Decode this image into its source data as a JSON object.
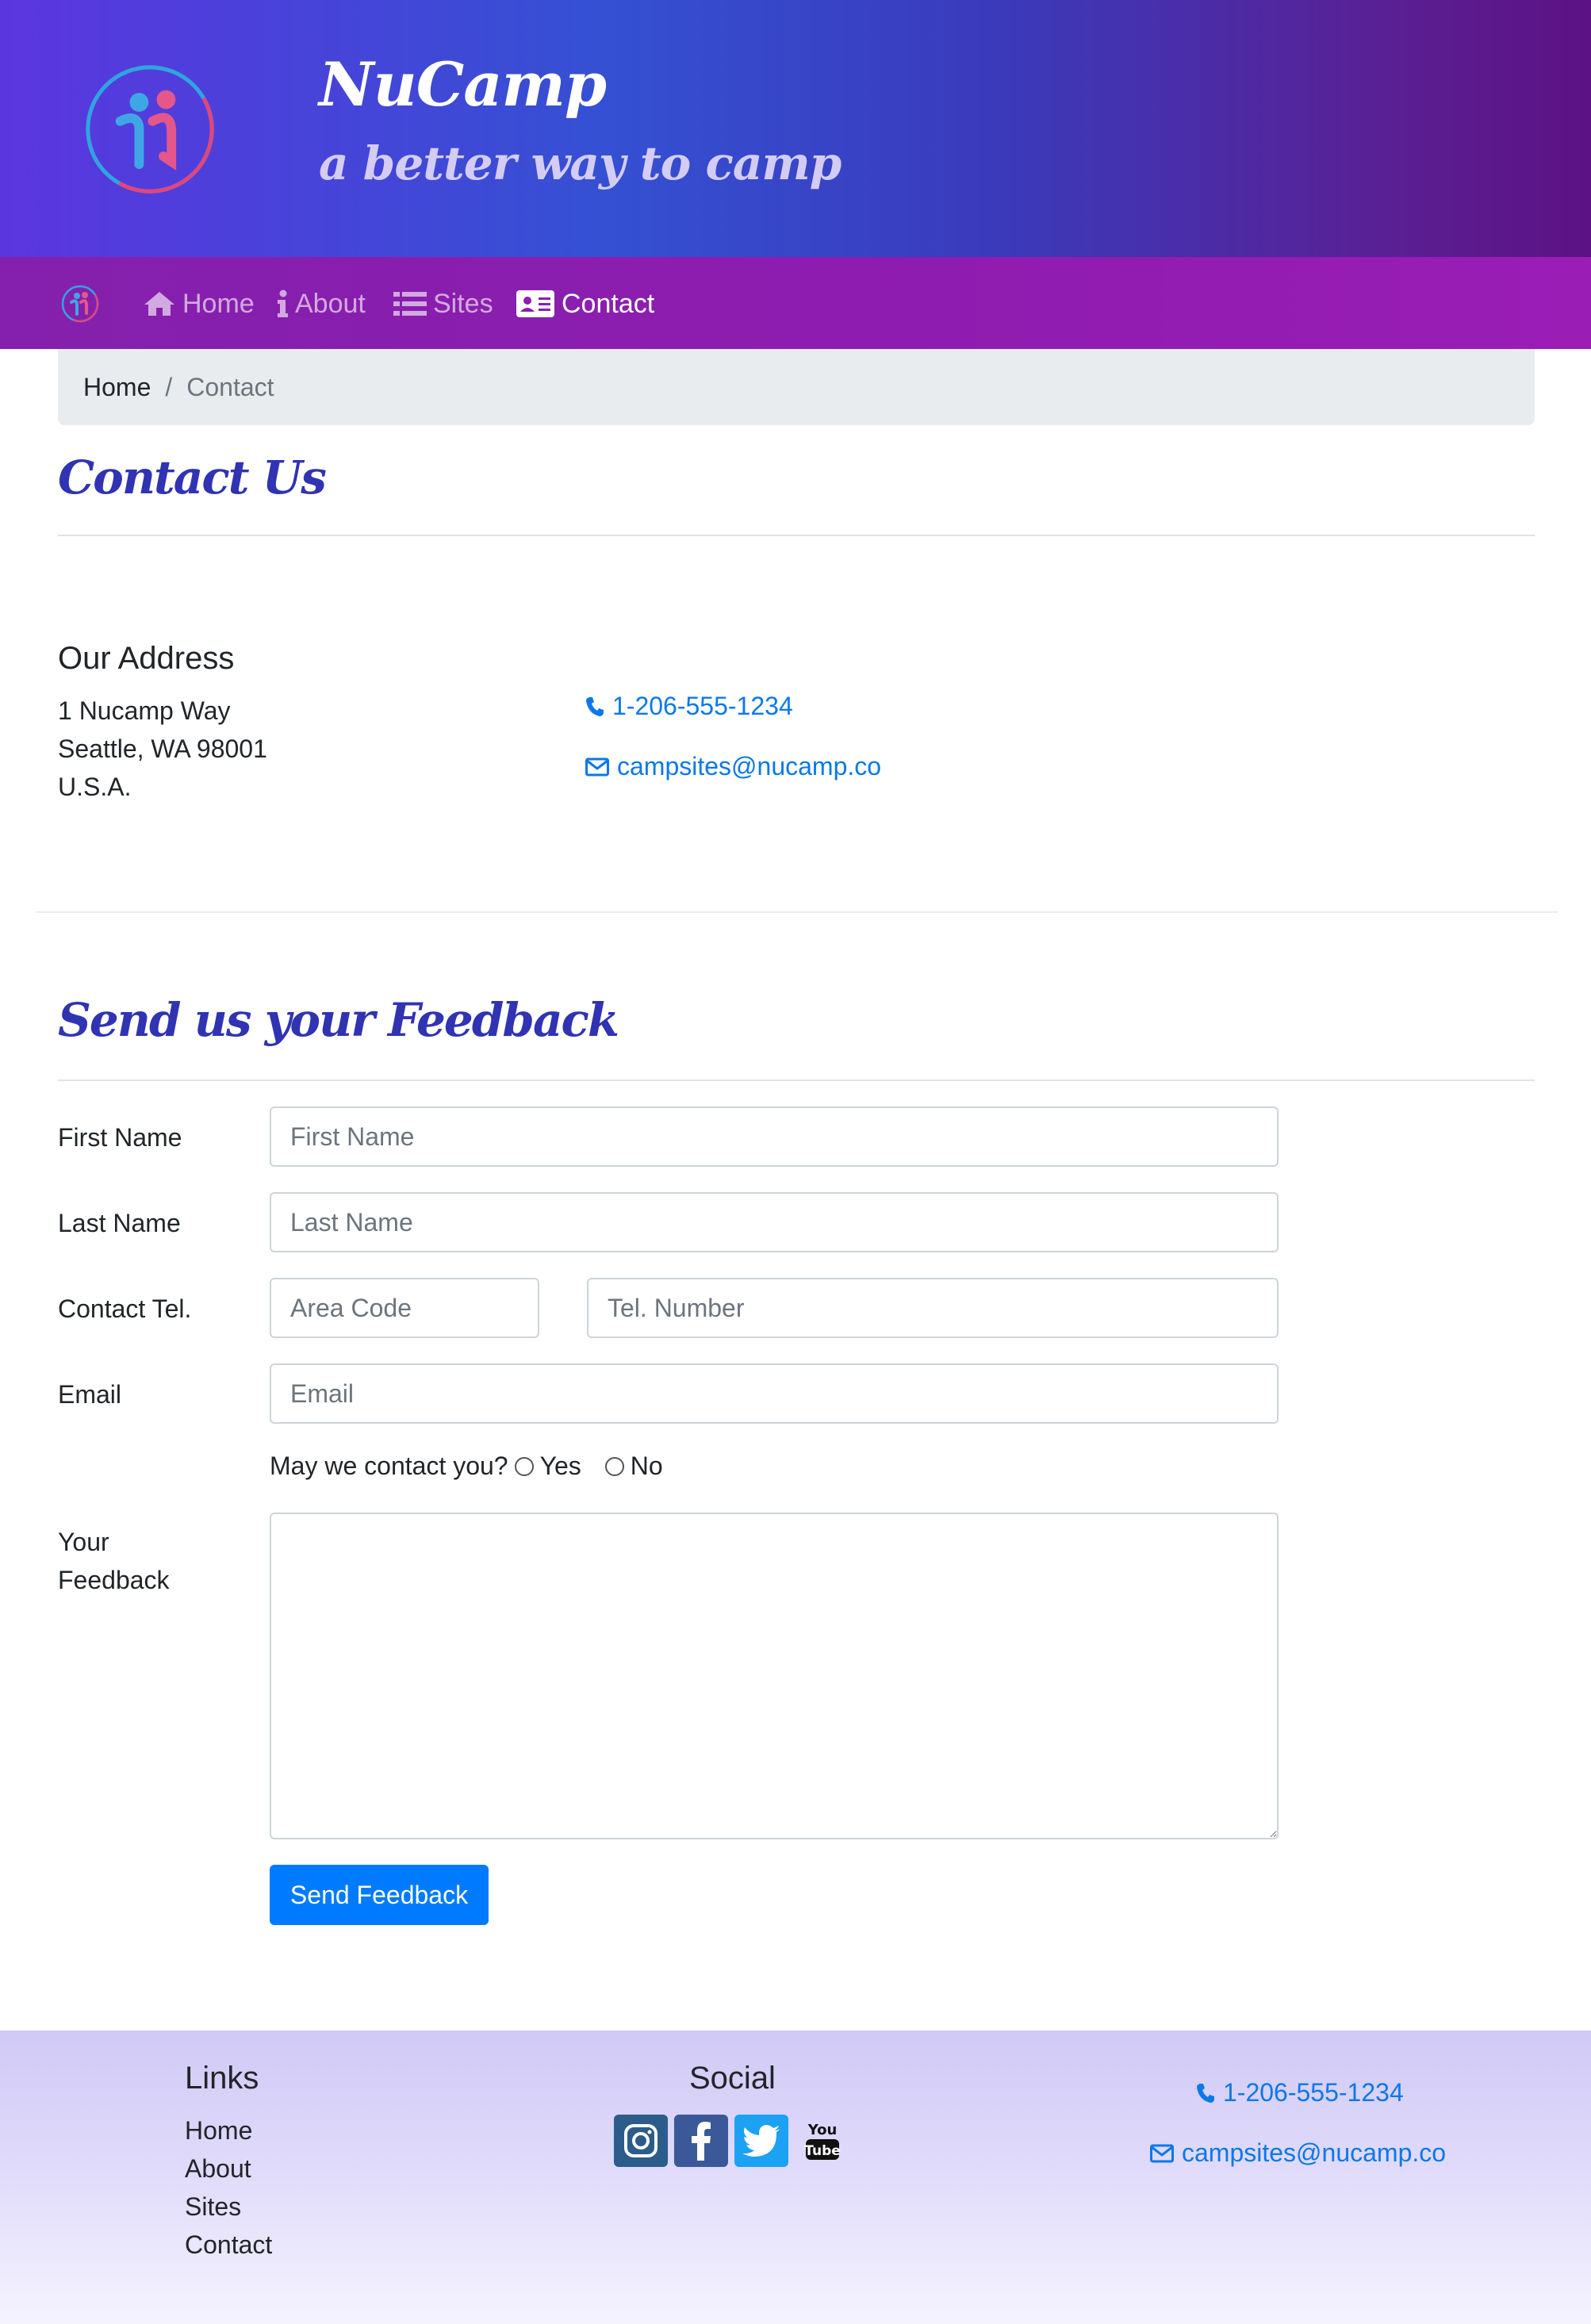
{
  "header": {
    "title": "NuCamp",
    "subtitle": "a better way to camp"
  },
  "navbar": {
    "items": [
      {
        "label": "Home",
        "icon": "home-icon",
        "active": false
      },
      {
        "label": "About",
        "icon": "info-icon",
        "active": false
      },
      {
        "label": "Sites",
        "icon": "list-icon",
        "active": false
      },
      {
        "label": "Contact",
        "icon": "address-card-icon",
        "active": true
      }
    ]
  },
  "breadcrumb": {
    "home": "Home",
    "separator": "/",
    "current": "Contact"
  },
  "contact": {
    "title": "Contact Us",
    "address_heading": "Our Address",
    "address_lines": [
      "1 Nucamp Way",
      "Seattle, WA 98001",
      "U.S.A."
    ],
    "phone": "1-206-555-1234",
    "email": "campsites@nucamp.co"
  },
  "feedback": {
    "title": "Send us your Feedback",
    "labels": {
      "first_name": "First Name",
      "last_name": "Last Name",
      "contact_tel": "Contact Tel.",
      "email": "Email",
      "feedback_line1": "Your",
      "feedback_line2": "Feedback"
    },
    "placeholders": {
      "first_name": "First Name",
      "last_name": "Last Name",
      "area_code": "Area Code",
      "tel_number": "Tel. Number",
      "email": "Email"
    },
    "contact_question": "May we contact you?",
    "radio_yes": "Yes",
    "radio_no": "No",
    "submit_label": "Send Feedback"
  },
  "footer": {
    "links_heading": "Links",
    "links": [
      "Home",
      "About",
      "Sites",
      "Contact"
    ],
    "social_heading": "Social",
    "social_icons": [
      "instagram-icon",
      "facebook-icon",
      "twitter-icon",
      "youtube-icon"
    ],
    "phone": "1-206-555-1234",
    "email": "campsites@nucamp.co"
  },
  "colors": {
    "accent_purple": "#8f1cb0",
    "heading_blue": "#3033b2",
    "link_blue": "#0b78ea",
    "button_blue": "#007bff"
  }
}
